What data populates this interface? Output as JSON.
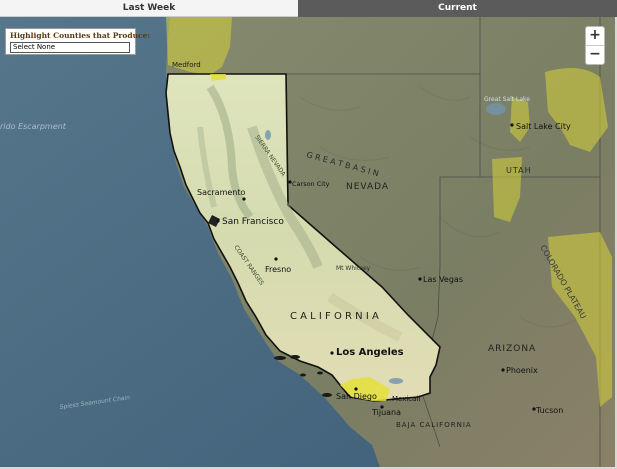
{
  "tabs": {
    "last_week": "Last Week",
    "current": "Current"
  },
  "filter": {
    "title": "Highlight Counties that Produce:",
    "selected": "Select None"
  },
  "zoom": {
    "in": "+",
    "out": "−"
  },
  "labels": {
    "medford": "Medford",
    "ridge_escarpment": "rido Escarpment",
    "sacramento": "Sacramento",
    "san_francisco": "San Francisco",
    "fresno": "Fresno",
    "mt_whitney": "Mt Whitney",
    "carson_city": "Carson City",
    "nevada": "NEVADA",
    "great_basin": "G R E A T   B A S I N",
    "great_salt_lake": "Great Salt Lake",
    "salt_lake_city": "Salt Lake City",
    "utah": "UTAH",
    "colorado_plateau": "COLORADO PLATEAU",
    "las_vegas": "Las Vegas",
    "california": "C A L I F O R N I A",
    "sierra_nevada": "SIERRA NEVADA",
    "coast_ranges": "COAST RANGES",
    "los_angeles": "Los Angeles",
    "san_diego": "San Diego",
    "tijuana": "Tijuana",
    "mexicali": "Mexicali",
    "arizona": "ARIZONA",
    "phoenix": "Phoenix",
    "tucson": "Tucson",
    "baja_california": "BAJA CALIFORNIA",
    "seamount": "Spiess Seamount Chain"
  },
  "colors": {
    "ocean": "#4a6b82",
    "land": "#7d8266",
    "california_fill": "#d9dfb5",
    "highlight": "#d6d23a",
    "border": "#111111"
  }
}
